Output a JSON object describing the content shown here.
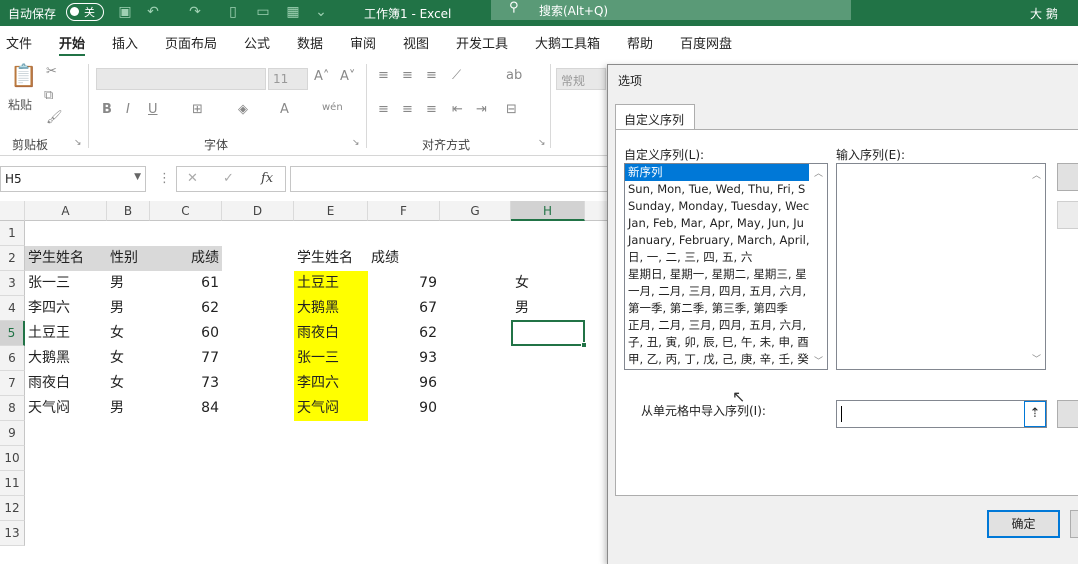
{
  "titlebar": {
    "autosave_label": "自动保存",
    "autosave_state": "关",
    "doc_title": "工作簿1  -  Excel",
    "search_placeholder": "搜索(Alt+Q)",
    "user": "大 鹅"
  },
  "menu": {
    "tabs": [
      "文件",
      "开始",
      "插入",
      "页面布局",
      "公式",
      "数据",
      "审阅",
      "视图",
      "开发工具",
      "大鹅工具箱",
      "帮助",
      "百度网盘"
    ],
    "active": "开始"
  },
  "ribbon": {
    "paste_label": "粘贴",
    "clipboard_group": "剪贴板",
    "font_group": "字体",
    "font_size": "11",
    "align_group": "对齐方式",
    "number_format": "常规"
  },
  "formula_bar": {
    "name_box": "H5",
    "fx": "fx"
  },
  "sheet": {
    "columns": [
      "A",
      "B",
      "C",
      "D",
      "E",
      "F",
      "G",
      "H"
    ],
    "selected_column": "H",
    "rows": [
      "1",
      "2",
      "3",
      "4",
      "5",
      "6",
      "7",
      "8",
      "9",
      "10",
      "11",
      "12",
      "13"
    ],
    "selected_row": "5",
    "table1": {
      "headers": [
        "学生姓名",
        "性别",
        "成绩"
      ],
      "data": [
        [
          "张一三",
          "男",
          "61"
        ],
        [
          "李四六",
          "男",
          "62"
        ],
        [
          "土豆王",
          "女",
          "60"
        ],
        [
          "大鹅黑",
          "女",
          "77"
        ],
        [
          "雨夜白",
          "女",
          "73"
        ],
        [
          "天气闷",
          "男",
          "84"
        ]
      ]
    },
    "table2": {
      "headers": [
        "学生姓名",
        "成绩"
      ],
      "data": [
        [
          "土豆王",
          "79"
        ],
        [
          "大鹅黑",
          "67"
        ],
        [
          "雨夜白",
          "62"
        ],
        [
          "张一三",
          "93"
        ],
        [
          "李四六",
          "96"
        ],
        [
          "天气闷",
          "90"
        ]
      ]
    },
    "h_values": [
      "女",
      "男"
    ]
  },
  "dialog": {
    "title": "选项",
    "tab_label": "自定义序列",
    "custom_lists_label": "自定义序列(L):",
    "entries_label": "输入序列(E):",
    "import_label": "从单元格中导入序列(I):",
    "ok_label": "确定",
    "lists": [
      "新序列",
      "Sun, Mon, Tue, Wed, Thu, Fri, S",
      "Sunday, Monday, Tuesday, Wec",
      "Jan, Feb, Mar, Apr, May, Jun, Ju",
      "January, February, March, April,",
      "日, 一, 二, 三, 四, 五, 六",
      "星期日, 星期一, 星期二, 星期三, 星",
      "一月, 二月, 三月, 四月, 五月, 六月,",
      "第一季, 第二季, 第三季, 第四季",
      "正月, 二月, 三月, 四月, 五月, 六月,",
      "子, 丑, 寅, 卯, 辰, 巳, 午, 未, 申, 酉",
      "甲, 乙, 丙, 丁, 戊, 己, 庚, 辛, 壬, 癸"
    ],
    "selected_list": "新序列"
  },
  "colors": {
    "excel_green": "#217346",
    "highlight_yellow": "#ffff00",
    "header_gray": "#d9d9d9",
    "selection_blue": "#0078d7"
  }
}
